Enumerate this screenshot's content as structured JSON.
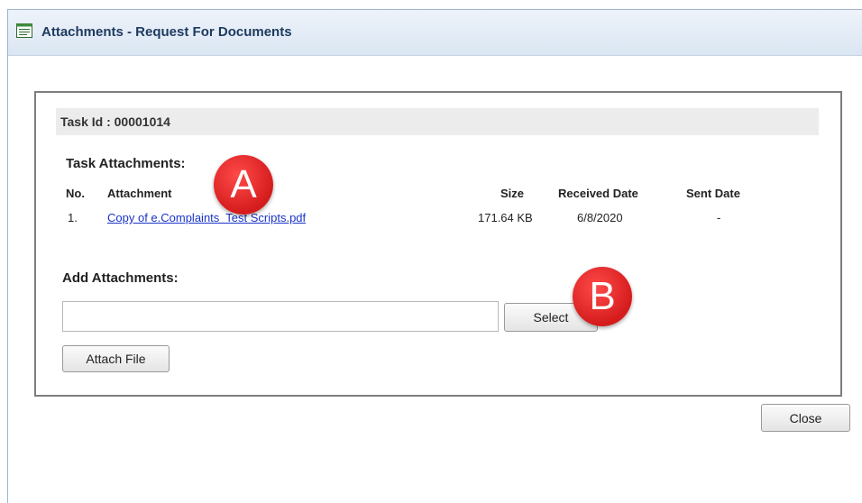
{
  "window": {
    "title": "Attachments - Request For Documents",
    "icon": "form-icon"
  },
  "task": {
    "header": "Task Id : 00001014"
  },
  "task_attachments": {
    "label": "Task Attachments:",
    "columns": {
      "no": "No.",
      "attachment": "Attachment",
      "size": "Size",
      "received_date": "Received Date",
      "sent_date": "Sent Date"
    },
    "rows": [
      {
        "no": "1.",
        "attachment": "Copy of e.Complaints  Test Scripts.pdf",
        "size": "171.64 KB",
        "received_date": "6/8/2020",
        "sent_date": "-"
      }
    ]
  },
  "add_attachments": {
    "label": "Add Attachments:",
    "file_value": "",
    "select_label": "Select",
    "attach_label": "Attach File"
  },
  "close_label": "Close",
  "annotations": {
    "a": "A",
    "b": "B",
    "color": "#e02525"
  }
}
